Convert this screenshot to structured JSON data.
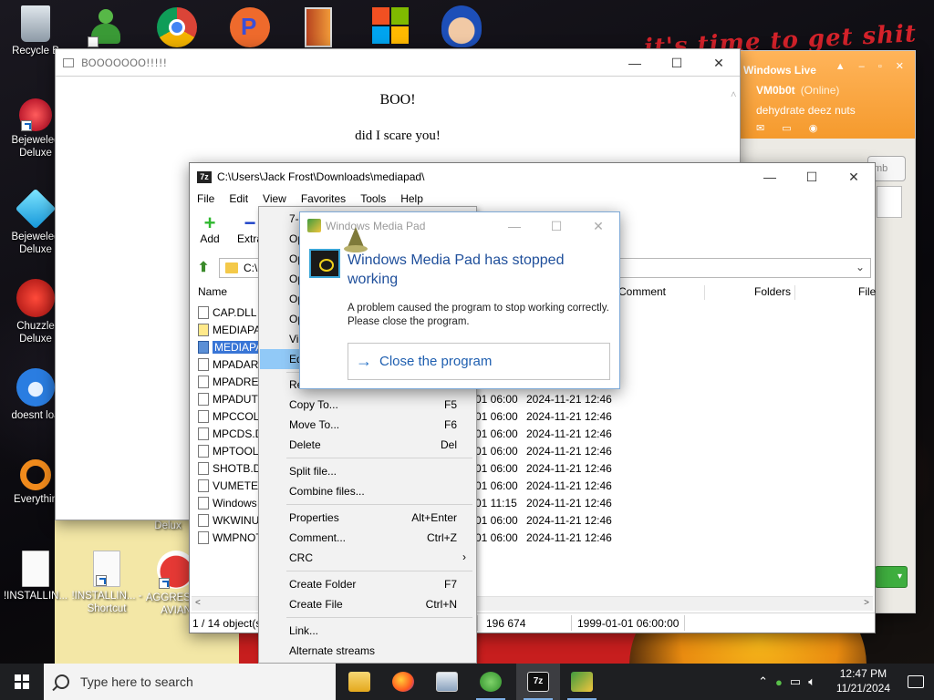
{
  "desktop": {
    "icons": [
      {
        "label": "Recycle B",
        "glyph": "recycle-bin-icon"
      },
      {
        "label": "Bejeweled Deluxe",
        "glyph": "bejeweled-icon"
      },
      {
        "label": "Bejeweled Deluxe",
        "glyph": "bejeweled-diamond-icon"
      },
      {
        "label": "Chuzzle Deluxe",
        "glyph": "chuzzle-icon"
      },
      {
        "label": "doesnt loa",
        "glyph": "thunderbird-icon"
      },
      {
        "label": "Everythin",
        "glyph": "everything-search-icon"
      },
      {
        "label": "!INSTALLIN...",
        "glyph": "document-icon"
      },
      {
        "label": "!INSTALLIN... - Shortcut",
        "glyph": "document-shortcut-icon"
      },
      {
        "label": "AGGRESS... AVIAN",
        "glyph": "angry-bird-icon"
      }
    ],
    "partial_label": "Delux",
    "wallpaper_text": "it's time to get shit"
  },
  "boo_window": {
    "title": "BOOOOOOO!!!!!",
    "line1": "BOO!",
    "line2": "did I scare you!"
  },
  "messenger": {
    "title": "Windows Live",
    "user": "VM0b0t",
    "status": "(Online)",
    "personal_message": "dehydrate deez nuts",
    "search_placeholder": "mb"
  },
  "sevenzip": {
    "title": "C:\\Users\\Jack Frost\\Downloads\\mediapad\\",
    "menu": [
      "File",
      "Edit",
      "View",
      "Favorites",
      "Tools",
      "Help"
    ],
    "toolbar": [
      {
        "label": "Add"
      },
      {
        "label": "Extra"
      }
    ],
    "path": "C:\\",
    "columns": {
      "name": "Name",
      "comment": "Comment",
      "folders": "Folders",
      "files": "File"
    },
    "files": [
      {
        "name": "CAP.DLL",
        "modified": "",
        "created": ""
      },
      {
        "name": "MEDIAPA",
        "modified": "",
        "created": ""
      },
      {
        "name": "MEDIAPA",
        "modified": "",
        "created": "",
        "selected": true
      },
      {
        "name": "MPADART",
        "modified": "",
        "created": ""
      },
      {
        "name": "MPADRES",
        "modified": "",
        "created": ""
      },
      {
        "name": "MPADUTI",
        "modified": "01 06:00",
        "created": "2024-11-21 12:46"
      },
      {
        "name": "MPCCOL",
        "modified": "01 06:00",
        "created": "2024-11-21 12:46"
      },
      {
        "name": "MPCDS.D",
        "modified": "01 06:00",
        "created": "2024-11-21 12:46"
      },
      {
        "name": "MPTOOLS",
        "modified": "01 06:00",
        "created": "2024-11-21 12:46"
      },
      {
        "name": "SHOTB.DI",
        "modified": "01 06:00",
        "created": "2024-11-21 12:46"
      },
      {
        "name": "VUMETER",
        "modified": "01 06:00",
        "created": "2024-11-21 12:46"
      },
      {
        "name": "Windows",
        "modified": "01 11:15",
        "created": "2024-11-21 12:46"
      },
      {
        "name": "WKWINU",
        "modified": "01 06:00",
        "created": "2024-11-21 12:46"
      },
      {
        "name": "WMPNOT",
        "modified": "01 06:00",
        "created": "2024-11-21 12:46"
      }
    ],
    "status": {
      "count": "1 / 14 object(s",
      "size": "196 674",
      "date": "1999-01-01 06:00:00"
    }
  },
  "context_menu": {
    "items": [
      {
        "label": "7-",
        "shortcut": ""
      },
      {
        "label": "Op",
        "shortcut": ""
      },
      {
        "label": "Op",
        "shortcut": ""
      },
      {
        "label": "Op",
        "shortcut": ""
      },
      {
        "label": "Op",
        "shortcut": ""
      },
      {
        "label": "Op",
        "shortcut": ""
      },
      {
        "label": "Vi",
        "shortcut": ""
      },
      {
        "label": "Ed",
        "shortcut": "",
        "highlight": true
      },
      {
        "label": "Re",
        "shortcut": ""
      },
      {
        "label": "Copy To...",
        "shortcut": "F5"
      },
      {
        "label": "Move To...",
        "shortcut": "F6"
      },
      {
        "label": "Delete",
        "shortcut": "Del"
      },
      {
        "label": "Split file...",
        "shortcut": ""
      },
      {
        "label": "Combine files...",
        "shortcut": ""
      },
      {
        "label": "Properties",
        "shortcut": "Alt+Enter"
      },
      {
        "label": "Comment...",
        "shortcut": "Ctrl+Z"
      },
      {
        "label": "CRC",
        "shortcut": "",
        "submenu": true
      },
      {
        "label": "Create Folder",
        "shortcut": "F7"
      },
      {
        "label": "Create File",
        "shortcut": "Ctrl+N"
      },
      {
        "label": "Link...",
        "shortcut": ""
      },
      {
        "label": "Alternate streams",
        "shortcut": ""
      }
    ]
  },
  "dialog": {
    "title": "Windows Media Pad",
    "heading": "Windows Media Pad has stopped working",
    "body": "A problem caused the program to stop working correctly. Please close the program.",
    "button": "Close the program"
  },
  "taskbar": {
    "search_placeholder": "Type here to search",
    "time": "12:47 PM",
    "date": "11/21/2024",
    "apps": [
      "file-explorer-icon",
      "firefox-icon",
      "control-panel-icon",
      "messenger-icon",
      "7zip-icon",
      "media-pad-icon"
    ]
  }
}
